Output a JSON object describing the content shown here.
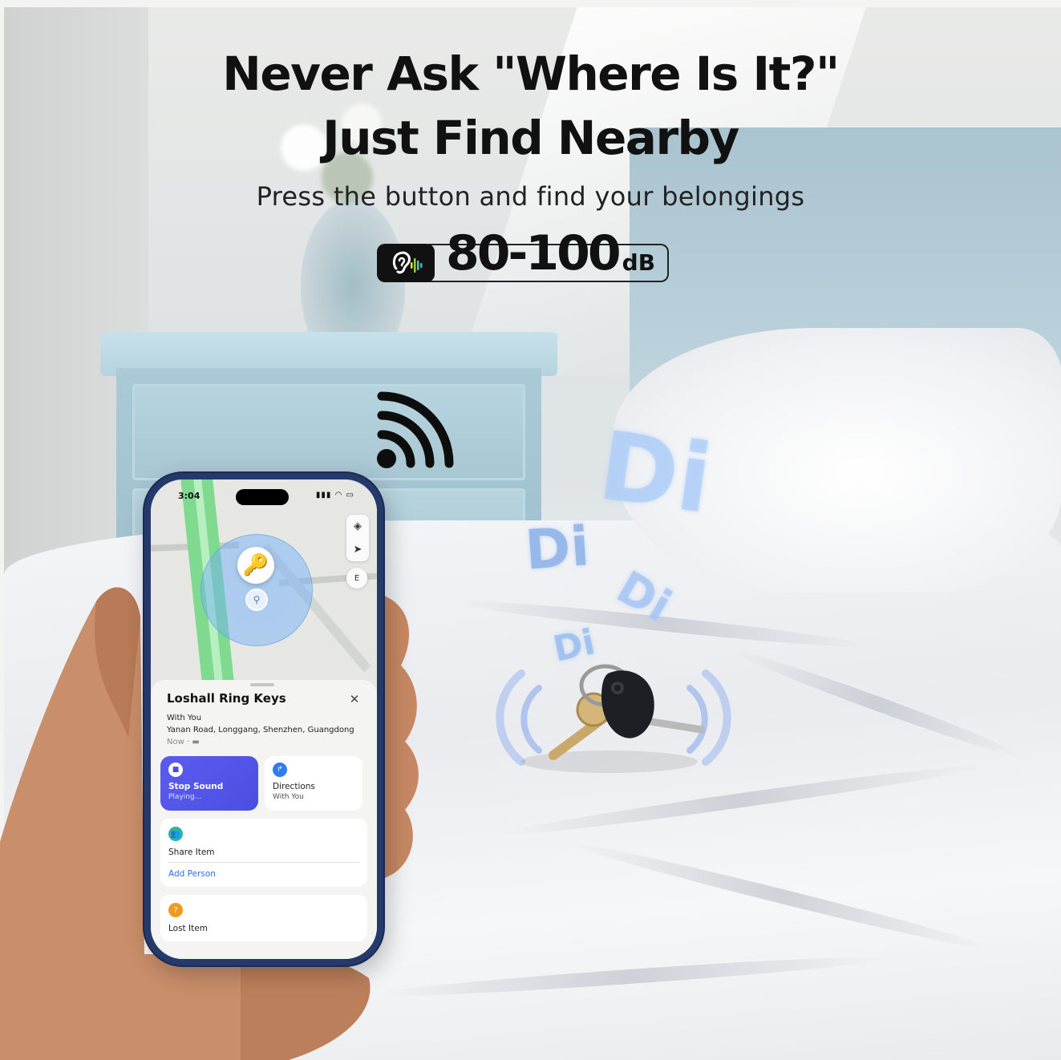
{
  "headline": {
    "line1": "Never Ask \"Where Is It?\"",
    "line2": "Just Find Nearby",
    "subtitle": "Press the button and find your belongings"
  },
  "decibel_badge": {
    "value": "80-100",
    "unit": "dB",
    "icon": "ear-sound-icon"
  },
  "sound_words": [
    "Di",
    "Di",
    "Di",
    "Di"
  ],
  "phone": {
    "status_bar": {
      "time": "3:04",
      "icons": [
        "location-arrow-icon",
        "signal-icon",
        "wifi-icon",
        "battery-icon"
      ]
    },
    "map": {
      "compass_label": "E",
      "controls": [
        "map-layers-icon",
        "locate-arrow-icon"
      ]
    },
    "sheet": {
      "title": "Loshall Ring Keys",
      "status": "With You",
      "address": "Yanan Road, Longgang, Shenzhen, Guangdong",
      "updated": "Now",
      "actions": [
        {
          "label": "Stop Sound",
          "sub": "Playing..."
        },
        {
          "label": "Directions",
          "sub": "With You"
        }
      ],
      "share": {
        "label": "Share Item",
        "link": "Add Person"
      },
      "lost": {
        "label": "Lost Item"
      }
    }
  },
  "colors": {
    "stop_sound": "#4b4fe0",
    "directions_icon": "#2f7bf5",
    "share_icon": "#2bb5a0",
    "lost_icon": "#f39a1e",
    "map_route": "#7fd98e",
    "phone_frame": "#253a6b"
  }
}
